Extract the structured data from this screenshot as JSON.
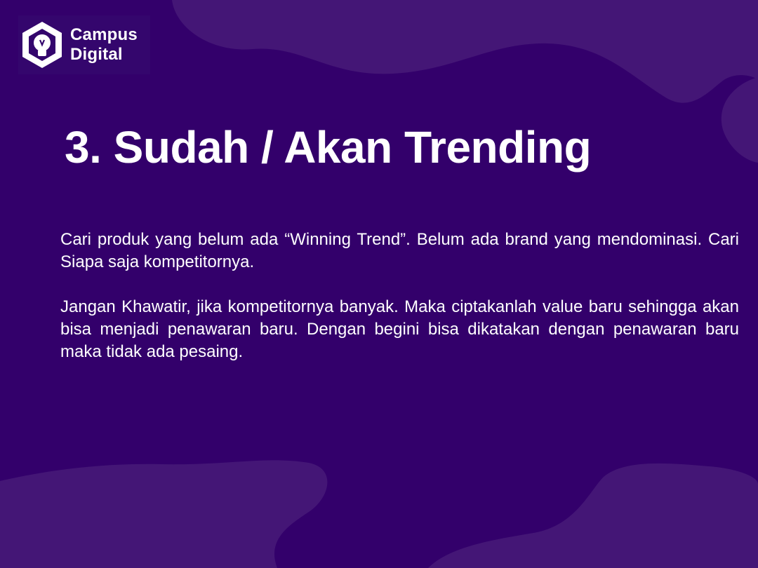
{
  "logo": {
    "icon": "lightbulb-hexagon-icon",
    "line1": "Campus",
    "line2": "Digital"
  },
  "slide": {
    "title": "3. Sudah / Akan Trending",
    "paragraphs": [
      "Cari produk yang belum ada “Winning Trend”. Belum ada brand yang mendominasi. Cari Siapa saja kompetitornya.",
      "Jangan Khawatir, jika kompetitornya banyak. Maka ciptakanlah value baru sehingga akan bisa menjadi penawaran baru. Dengan begini bisa dikatakan dengan penawaran baru maka tidak ada pesaing."
    ]
  },
  "colors": {
    "background": "#33006b",
    "blob": "#431474",
    "text": "#ffffff"
  }
}
